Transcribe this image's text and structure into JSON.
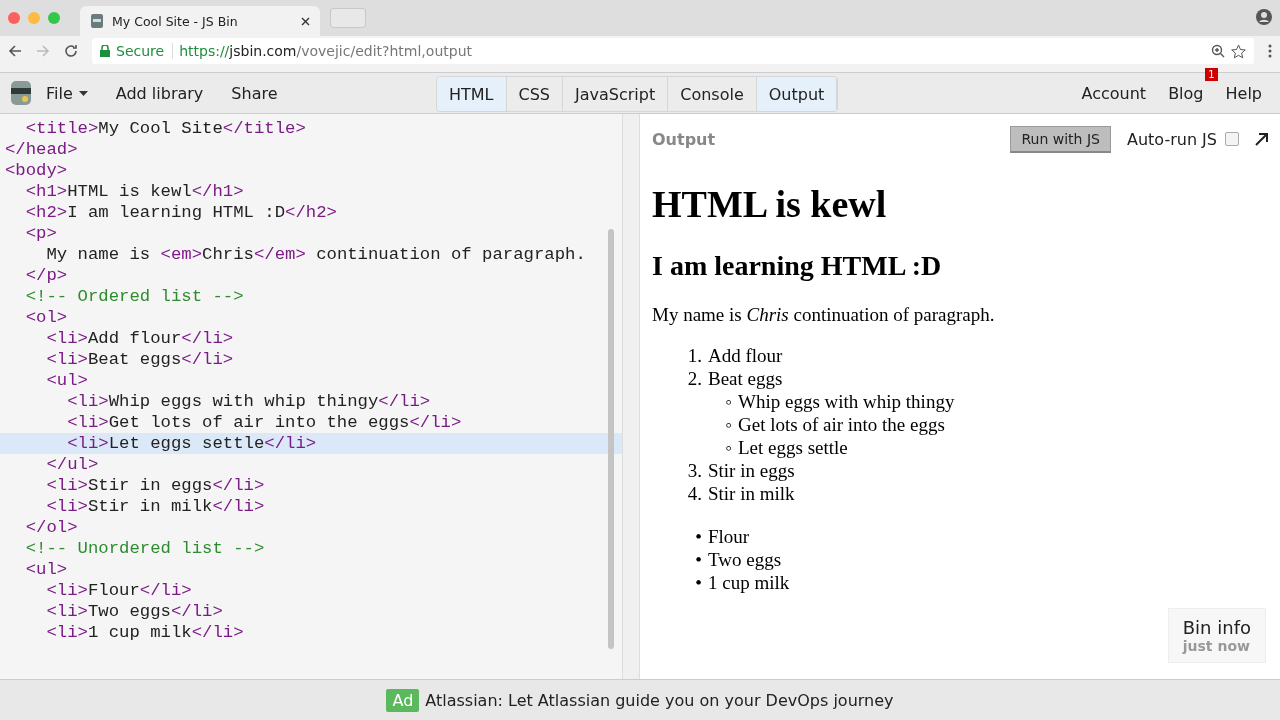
{
  "browser": {
    "tab_title": "My Cool Site - JS Bin",
    "secure_label": "Secure",
    "url_scheme": "https://",
    "url_host": "jsbin.com",
    "url_path": "/vovejic/edit?html,output"
  },
  "toolbar": {
    "menu": [
      {
        "label": "File",
        "kind": "dropdown"
      },
      {
        "label": "Add library",
        "kind": "plain"
      },
      {
        "label": "Share",
        "kind": "plain"
      }
    ],
    "panels": [
      {
        "label": "HTML",
        "selected": true
      },
      {
        "label": "CSS",
        "selected": false
      },
      {
        "label": "JavaScript",
        "selected": false
      },
      {
        "label": "Console",
        "selected": false
      },
      {
        "label": "Output",
        "selected": true
      }
    ],
    "links": [
      {
        "label": "Account"
      },
      {
        "label": "Blog",
        "badge": "1"
      },
      {
        "label": "Help"
      }
    ]
  },
  "editor": {
    "lines": [
      {
        "current": false,
        "tokens": [
          {
            "kind": "tag",
            "text": "  <title>"
          },
          {
            "kind": "text",
            "text": "My Cool Site"
          },
          {
            "kind": "tag",
            "text": "</title>"
          }
        ]
      },
      {
        "current": false,
        "tokens": [
          {
            "kind": "tag",
            "text": "</head>"
          }
        ]
      },
      {
        "current": false,
        "tokens": [
          {
            "kind": "tag",
            "text": "<body>"
          }
        ]
      },
      {
        "current": false,
        "tokens": [
          {
            "kind": "tag",
            "text": "  <h1>"
          },
          {
            "kind": "text",
            "text": "HTML is kewl"
          },
          {
            "kind": "tag",
            "text": "</h1>"
          }
        ]
      },
      {
        "current": false,
        "tokens": [
          {
            "kind": "tag",
            "text": "  <h2>"
          },
          {
            "kind": "text",
            "text": "I am learning HTML :D"
          },
          {
            "kind": "tag",
            "text": "</h2>"
          }
        ]
      },
      {
        "current": false,
        "tokens": [
          {
            "kind": "tag",
            "text": "  <p>"
          }
        ]
      },
      {
        "current": false,
        "tokens": [
          {
            "kind": "text",
            "text": "    My name is "
          },
          {
            "kind": "tag",
            "text": "<em>"
          },
          {
            "kind": "text",
            "text": "Chris"
          },
          {
            "kind": "tag",
            "text": "</em>"
          },
          {
            "kind": "text",
            "text": " continuation of paragraph."
          }
        ]
      },
      {
        "current": false,
        "tokens": [
          {
            "kind": "tag",
            "text": "  </p>"
          }
        ]
      },
      {
        "current": false,
        "tokens": [
          {
            "kind": "comment",
            "text": "  <!-- Ordered list -->"
          }
        ]
      },
      {
        "current": false,
        "tokens": [
          {
            "kind": "tag",
            "text": "  <ol>"
          }
        ]
      },
      {
        "current": false,
        "tokens": [
          {
            "kind": "tag",
            "text": "    <li>"
          },
          {
            "kind": "text",
            "text": "Add flour"
          },
          {
            "kind": "tag",
            "text": "</li>"
          }
        ]
      },
      {
        "current": false,
        "tokens": [
          {
            "kind": "tag",
            "text": "    <li>"
          },
          {
            "kind": "text",
            "text": "Beat eggs"
          },
          {
            "kind": "tag",
            "text": "</li>"
          }
        ]
      },
      {
        "current": false,
        "tokens": [
          {
            "kind": "tag",
            "text": "    <ul>"
          }
        ]
      },
      {
        "current": false,
        "tokens": [
          {
            "kind": "tag",
            "text": "      <li>"
          },
          {
            "kind": "text",
            "text": "Whip eggs with whip thingy"
          },
          {
            "kind": "tag",
            "text": "</li>"
          }
        ]
      },
      {
        "current": false,
        "tokens": [
          {
            "kind": "tag",
            "text": "      <li>"
          },
          {
            "kind": "text",
            "text": "Get lots of air into the eggs"
          },
          {
            "kind": "tag",
            "text": "</li>"
          }
        ]
      },
      {
        "current": true,
        "tokens": [
          {
            "kind": "tag",
            "text": "      <li>"
          },
          {
            "kind": "text",
            "text": "Let eggs settle"
          },
          {
            "kind": "tag",
            "text": "</li>"
          }
        ]
      },
      {
        "current": false,
        "tokens": [
          {
            "kind": "tag",
            "text": "    </ul>"
          }
        ]
      },
      {
        "current": false,
        "tokens": [
          {
            "kind": "tag",
            "text": "    <li>"
          },
          {
            "kind": "text",
            "text": "Stir in eggs"
          },
          {
            "kind": "tag",
            "text": "</li>"
          }
        ]
      },
      {
        "current": false,
        "tokens": [
          {
            "kind": "tag",
            "text": "    <li>"
          },
          {
            "kind": "text",
            "text": "Stir in milk"
          },
          {
            "kind": "tag",
            "text": "</li>"
          }
        ]
      },
      {
        "current": false,
        "tokens": [
          {
            "kind": "tag",
            "text": "  </ol>"
          }
        ]
      },
      {
        "current": false,
        "tokens": [
          {
            "kind": "comment",
            "text": "  <!-- Unordered list -->"
          }
        ]
      },
      {
        "current": false,
        "tokens": [
          {
            "kind": "tag",
            "text": "  <ul>"
          }
        ]
      },
      {
        "current": false,
        "tokens": [
          {
            "kind": "tag",
            "text": "    <li>"
          },
          {
            "kind": "text",
            "text": "Flour"
          },
          {
            "kind": "tag",
            "text": "</li>"
          }
        ]
      },
      {
        "current": false,
        "tokens": [
          {
            "kind": "tag",
            "text": "    <li>"
          },
          {
            "kind": "text",
            "text": "Two eggs"
          },
          {
            "kind": "tag",
            "text": "</li>"
          }
        ]
      },
      {
        "current": false,
        "tokens": [
          {
            "kind": "tag",
            "text": "    <li>"
          },
          {
            "kind": "text",
            "text": "1 cup milk"
          },
          {
            "kind": "tag",
            "text": "</li>"
          }
        ]
      }
    ]
  },
  "output": {
    "title": "Output",
    "run_button": "Run with JS",
    "autorun": {
      "label": "Auto-run JS",
      "checked": false
    },
    "content": [
      {
        "kind": "h1",
        "text": "HTML is kewl"
      },
      {
        "kind": "h2",
        "text": "I am learning HTML :D"
      },
      {
        "kind": "p",
        "text": "My name is *Chris* continuation of paragraph."
      },
      {
        "kind": "ol",
        "items": [
          {
            "marker": "1.",
            "text": "Add flour"
          },
          {
            "marker": "2.",
            "text": "Beat eggs",
            "children": [
              {
                "marker": "◦",
                "text": "Whip eggs with whip thingy"
              },
              {
                "marker": "◦",
                "text": "Get lots of air into the eggs"
              },
              {
                "marker": "◦",
                "text": "Let eggs settle"
              }
            ]
          },
          {
            "marker": "3.",
            "text": "Stir in eggs"
          },
          {
            "marker": "4.",
            "text": "Stir in milk"
          }
        ]
      },
      {
        "kind": "ul",
        "items": [
          {
            "marker": "•",
            "text": "Flour"
          },
          {
            "marker": "•",
            "text": "Two eggs"
          },
          {
            "marker": "•",
            "text": "1 cup milk"
          }
        ]
      }
    ],
    "bin_info": {
      "title": "Bin info",
      "time": "just now"
    }
  },
  "ad": {
    "badge": "Ad",
    "text": "Atlassian: Let Atlassian guide you on your DevOps journey"
  }
}
